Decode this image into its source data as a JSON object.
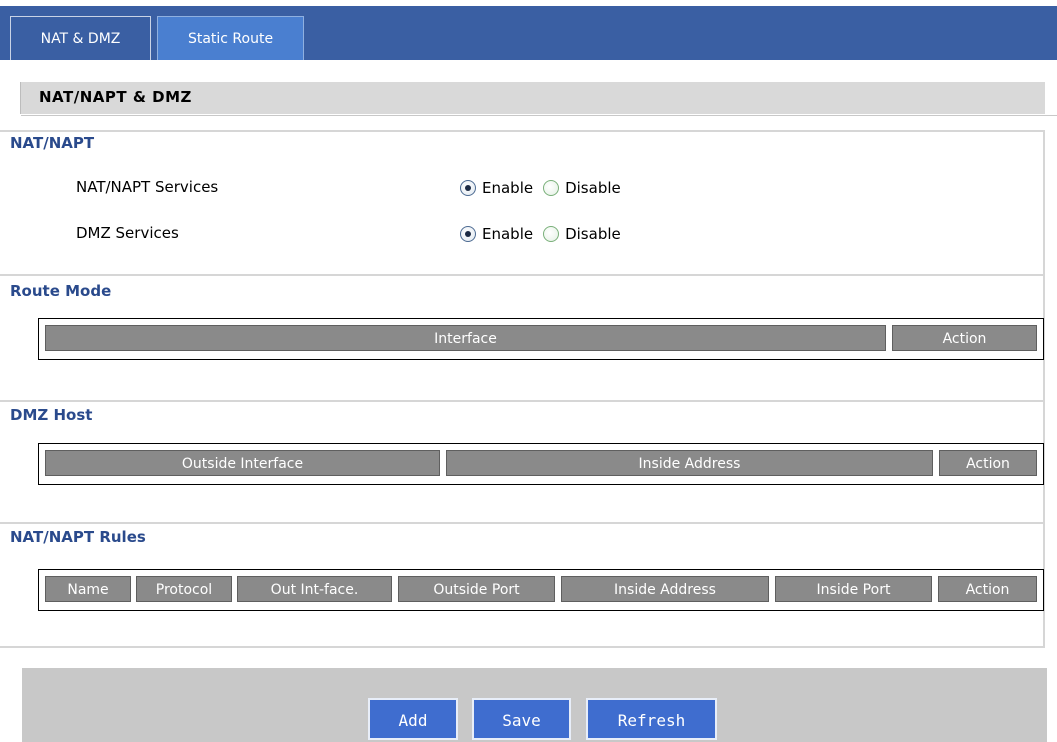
{
  "header": {
    "tabs": [
      {
        "label": "NAT & DMZ",
        "active": true
      },
      {
        "label": "Static Route",
        "active": false
      }
    ]
  },
  "page": {
    "title": "NAT/NAPT & DMZ"
  },
  "nat_napt": {
    "title": "NAT/NAPT",
    "rows": [
      {
        "label": "NAT/NAPT Services",
        "enable_label": "Enable",
        "disable_label": "Disable",
        "selected": "Enable"
      },
      {
        "label": "DMZ Services",
        "enable_label": "Enable",
        "disable_label": "Disable",
        "selected": "Enable"
      }
    ]
  },
  "route_mode": {
    "title": "Route Mode",
    "columns": [
      "Interface",
      "Action"
    ]
  },
  "dmz_host": {
    "title": "DMZ Host",
    "columns": [
      "Outside Interface",
      "Inside Address",
      "Action"
    ]
  },
  "nat_rules": {
    "title": "NAT/NAPT Rules",
    "columns": [
      "Name",
      "Protocol",
      "Out Int-face.",
      "Outside Port",
      "Inside Address",
      "Inside Port",
      "Action"
    ]
  },
  "footer": {
    "add_label": "Add",
    "save_label": "Save",
    "refresh_label": "Refresh"
  },
  "colors": {
    "header_blue": "#3a5fa3",
    "section_title": "#2a4a8c",
    "table_header": "#8a8a8a",
    "button_blue": "#3f6dcf"
  }
}
